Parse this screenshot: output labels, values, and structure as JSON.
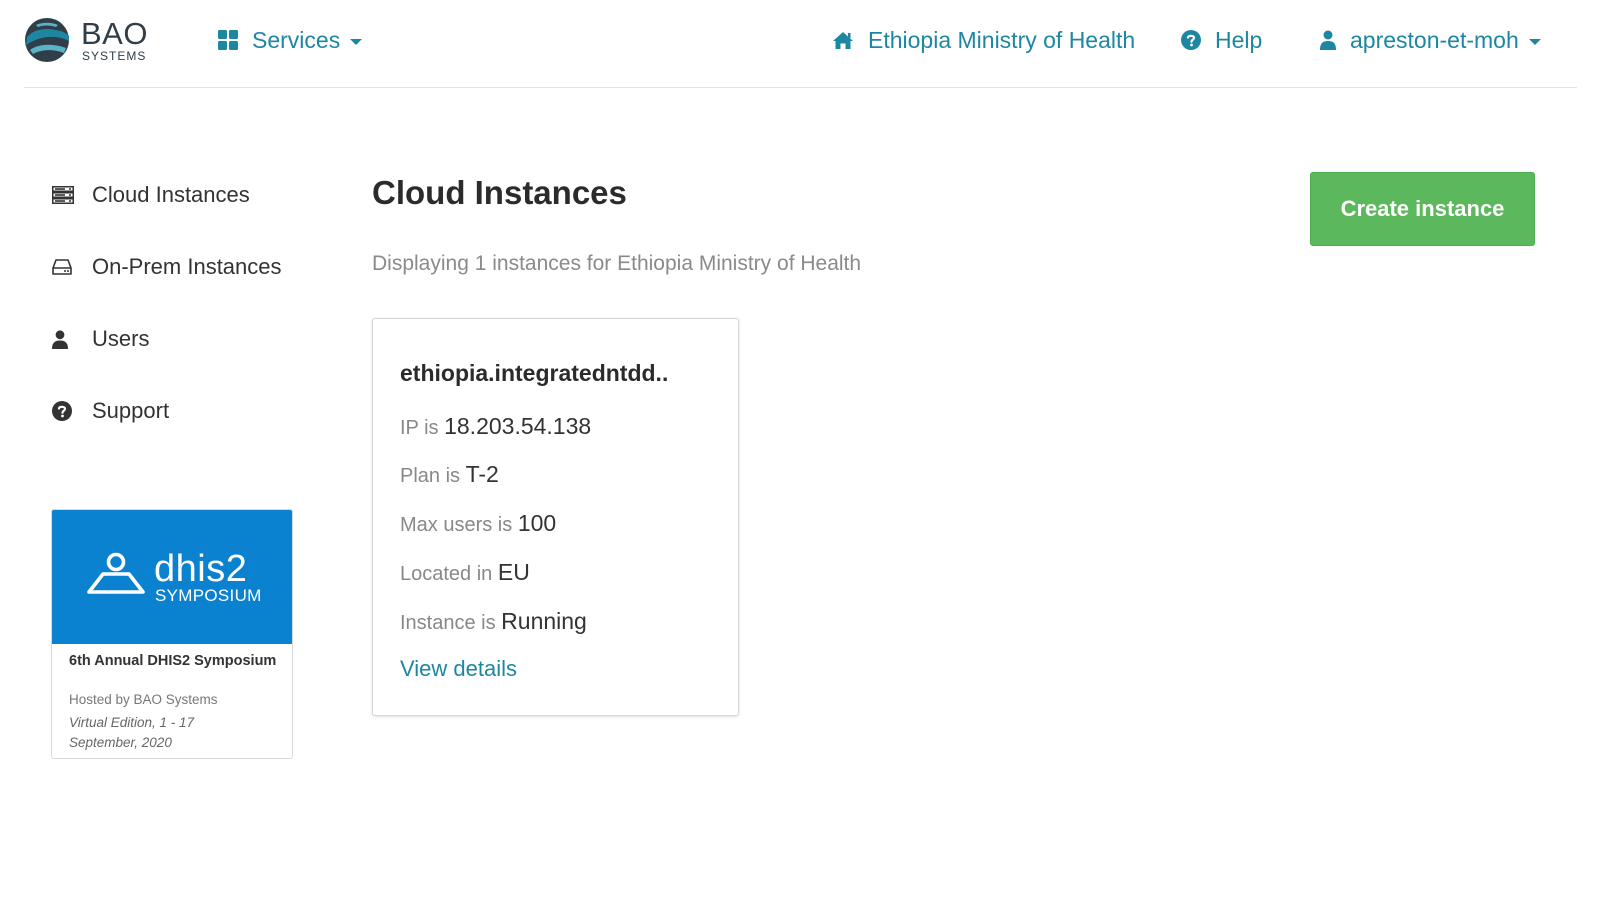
{
  "brand": {
    "name": "BAO",
    "sub": "SYSTEMS",
    "colors": {
      "dark": "#2f3e48",
      "accent": "#1d87a1"
    }
  },
  "header": {
    "services_label": "Services",
    "services_icon": "grid-icon",
    "org_label": "Ethiopia Ministry of Health",
    "org_icon": "home-icon",
    "help_label": "Help",
    "help_icon": "question-circle-icon",
    "user_label": "apreston-et-moh",
    "user_icon": "user-icon"
  },
  "sidebar": {
    "items": [
      {
        "label": "Cloud Instances",
        "icon": "server-icon"
      },
      {
        "label": "On-Prem Instances",
        "icon": "hard-drive-icon"
      },
      {
        "label": "Users",
        "icon": "user-icon"
      },
      {
        "label": "Support",
        "icon": "question-circle-icon"
      }
    ],
    "promo": {
      "banner_word": "dhis2",
      "banner_sub": "SYMPOSIUM",
      "title": "6th Annual DHIS2 Symposium",
      "host": "Hosted by BAO Systems",
      "date": "Virtual Edition, 1 - 17 September, 2020",
      "banner_color": "#0a82cf"
    }
  },
  "main": {
    "title": "Cloud Instances",
    "subtitle": "Displaying 1 instances for Ethiopia Ministry of Health",
    "create_button": "Create instance",
    "create_button_color": "#5cb85c",
    "instances": [
      {
        "name": "ethiopia.integratedntdd..",
        "ip_label": "IP is",
        "ip": "18.203.54.138",
        "plan_label": "Plan is",
        "plan": "T-2",
        "max_users_label": "Max users is",
        "max_users": "100",
        "location_label": "Located in",
        "location": "EU",
        "status_label": "Instance is",
        "status": "Running",
        "details_link": "View details"
      }
    ]
  }
}
